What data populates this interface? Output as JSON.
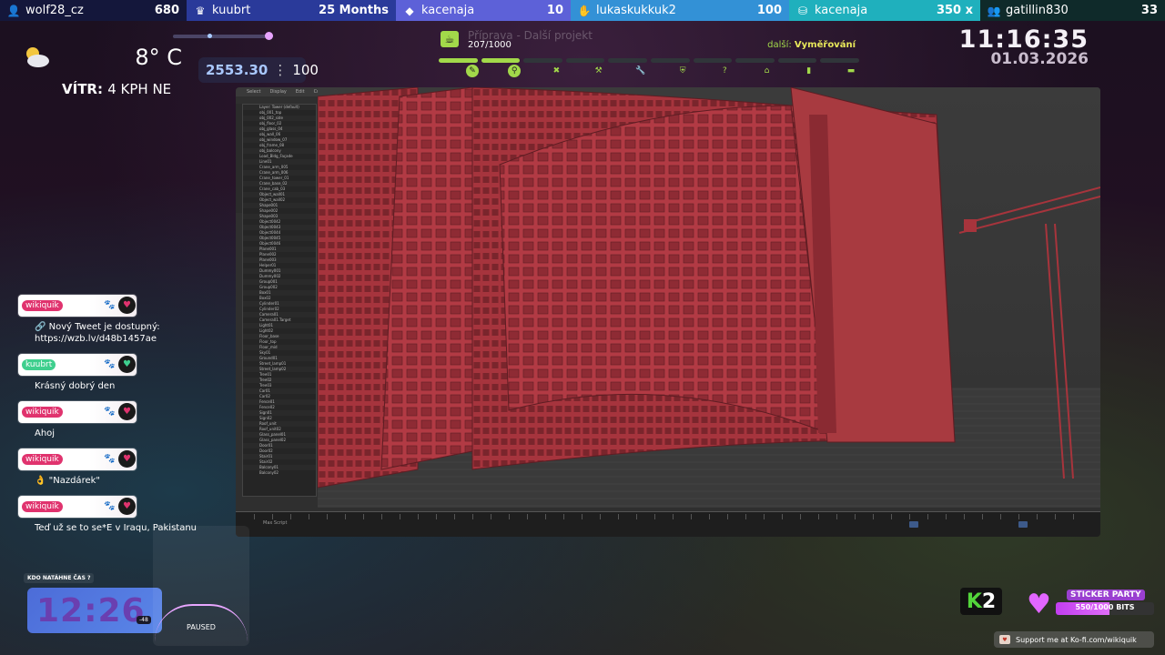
{
  "topbar": {
    "segments": [
      {
        "icon": "user-plus-icon",
        "name": "wolf28_cz",
        "value": "680",
        "bg": "#14173b",
        "width": 205
      },
      {
        "icon": "crown-icon",
        "name": "kuubrt",
        "value": "25 Months",
        "bg": "#2a3a9a",
        "width": 230
      },
      {
        "icon": "diamond-icon",
        "name": "kacenaja",
        "value": "10",
        "bg": "#5d61d8",
        "width": 192
      },
      {
        "icon": "hand-icon",
        "name": "lukaskukkuk2",
        "value": "100",
        "suffix": "·",
        "bg": "#3391d6",
        "width": 240
      },
      {
        "icon": "coins-icon",
        "name": "kacenaja",
        "value": "350 x",
        "bg": "#1fb0bd",
        "width": 210
      },
      {
        "icon": "people-icon",
        "name": "gatillin830",
        "value": "33",
        "bg": "#0f2a2a",
        "width": 203
      }
    ]
  },
  "weather": {
    "temp": "8° C",
    "wind_label": "VÍTR:",
    "wind_value": "4 KPH NE"
  },
  "counter": {
    "left": "2553.30",
    "sep": "⋮",
    "right": "100"
  },
  "goal": {
    "title": "Příprava - Další projekt",
    "count": "207/1000",
    "next_label": "další:",
    "next_value": "Vyměřování",
    "segments_done": 2,
    "segments_total": 10,
    "icons": [
      "pencil-icon",
      "pin-icon",
      "x-icon",
      "hammer-icon",
      "wrench-icon",
      "shield-icon",
      "question-icon",
      "house-icon",
      "book-icon",
      "ticket-icon"
    ]
  },
  "clock": {
    "time": "11:16:35",
    "date": "01.03.2026"
  },
  "app": {
    "menu": [
      "Select",
      "Display",
      "Edit",
      "Customize"
    ],
    "status": "Max Script",
    "tree": [
      "Layer: Tower (default)",
      "obj_001_top",
      "obj_002_side",
      "obj_floor_02",
      "obj_glass_04",
      "obj_wall_06",
      "obj_window_07",
      "obj_frame_08",
      "obj_balcony",
      "Load_Bldg_Façade",
      "Line01",
      "Crane_arm_005",
      "Crane_arm_006",
      "Crane_tower_01",
      "Crane_base_02",
      "Crane_cab_03",
      "Object_wall01",
      "Object_wall02",
      "Shape001",
      "Shape002",
      "Shape003",
      "Object0042",
      "Object0043",
      "Object0044",
      "Object0045",
      "Object0046",
      "Plane001",
      "Plane002",
      "Plane003",
      "Helper01",
      "Dummy001",
      "Dummy002",
      "Group001",
      "Group002",
      "Box01",
      "Box02",
      "Cylinder01",
      "Cylinder02",
      "Camera01",
      "Camera01.Target",
      "Light01",
      "Light02",
      "Floor_base",
      "Floor_top",
      "Floor_mid",
      "Sky01",
      "Ground01",
      "Street_lamp01",
      "Street_lamp02",
      "Tree01",
      "Tree02",
      "Tree03",
      "Car01",
      "Car02",
      "Fence01",
      "Fence02",
      "Sign01",
      "Sign02",
      "Roof_unit",
      "Roof_unit02",
      "Glass_panel01",
      "Glass_panel02",
      "Door01",
      "Door02",
      "Stair01",
      "Stair02",
      "Balcony01",
      "Balcony02"
    ]
  },
  "chat": [
    {
      "user": "wikiquik",
      "tag_color": "#e0336e",
      "text": "🔗 Nový Tweet je dostupný: https://wzb.lv/d48b1457ae",
      "line2": "https://wzb.lv/d48b1457ae",
      "line1": "🔗 Nový Tweet je dostupný:"
    },
    {
      "user": "kuubrt",
      "tag_color": "#3fcf8e",
      "line1": "Krásný dobrý den",
      "line2": ""
    },
    {
      "user": "wikiquik",
      "tag_color": "#e0336e",
      "line1": "Ahoj",
      "line2": ""
    },
    {
      "user": "wikiquik",
      "tag_color": "#e0336e",
      "line1": "👌 \"Nazdárek\"",
      "line2": ""
    },
    {
      "user": "wikiquik",
      "tag_color": "#e0336e",
      "line1": "Teď už se to se*E v Iraqu, Pakistanu",
      "line2": ""
    }
  ],
  "bottom": {
    "kdo_label": "KDO NATÁHNE ČAS ?",
    "kclock": "12:26",
    "kbadge": "-48",
    "paused": "PAUSED",
    "k2_k": "K",
    "k2_2": "2",
    "sticker_title": "STICKER PARTY",
    "sticker_value": "550/1000 BITS",
    "sticker_progress": 0.55,
    "kofi": "Support me at Ko-fi.com/wikiquik"
  },
  "colors": {
    "accent_green": "#a2d94a",
    "sticker_purple": "#c23ef0",
    "building_red": "#a83a40"
  }
}
